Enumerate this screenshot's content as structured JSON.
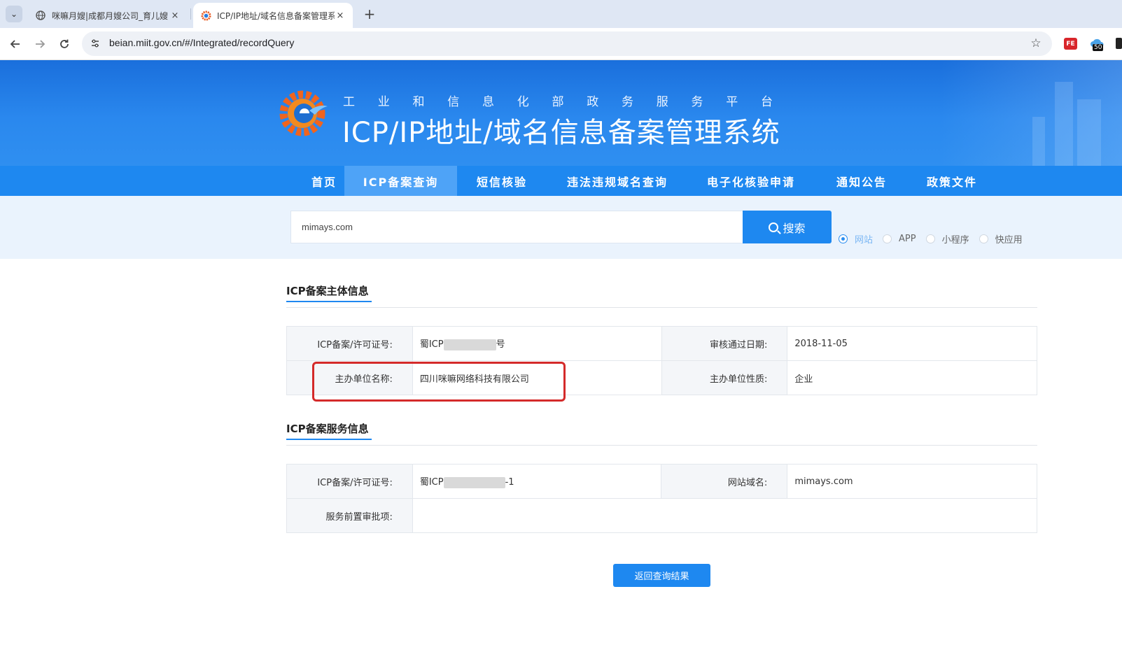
{
  "browser": {
    "tabs": [
      {
        "title": "咪嘛月嫂|成都月嫂公司_育儿嫂",
        "active": false
      },
      {
        "title": "ICP/IP地址/域名信息备案管理系",
        "active": true
      }
    ],
    "tab_close_glyph": "×",
    "new_tab_glyph": "+",
    "url": "beian.miit.gov.cn/#/Integrated/recordQuery",
    "extension_badge": "50",
    "extension_fe_label": "FE",
    "icons": [
      "chevron-down-icon",
      "globe-icon",
      "back-arrow-icon",
      "forward-arrow-icon",
      "reload-icon",
      "site-info-icon",
      "star-icon"
    ]
  },
  "header": {
    "subtitle_chars": [
      "工",
      "业",
      "和",
      "信",
      "息",
      "化",
      "部",
      "政",
      "务",
      "服",
      "务",
      "平",
      "台"
    ],
    "title": "ICP/IP地址/域名信息备案管理系统"
  },
  "nav": {
    "items": [
      {
        "label": "首页",
        "active": false
      },
      {
        "label": "ICP备案查询",
        "active": true
      },
      {
        "label": "短信核验",
        "active": false
      },
      {
        "label": "违法违规域名查询",
        "active": false
      },
      {
        "label": "电子化核验申请",
        "active": false
      },
      {
        "label": "通知公告",
        "active": false
      },
      {
        "label": "政策文件",
        "active": false
      }
    ]
  },
  "search": {
    "value": "mimays.com",
    "button_label": "搜索",
    "types": [
      {
        "label": "网站",
        "checked": true
      },
      {
        "label": "APP",
        "checked": false
      },
      {
        "label": "小程序",
        "checked": false
      },
      {
        "label": "快应用",
        "checked": false
      }
    ]
  },
  "subject_section": {
    "title": "ICP备案主体信息",
    "rows": [
      {
        "k1": "ICP备案/许可证号:",
        "v1_prefix": "蜀ICP",
        "v1_suffix": "号",
        "k2": "审核通过日期:",
        "v2": "2018-11-05"
      },
      {
        "k1": "主办单位名称:",
        "v1": "四川咪嘛网络科技有限公司",
        "k2": "主办单位性质:",
        "v2": "企业"
      }
    ]
  },
  "service_section": {
    "title": "ICP备案服务信息",
    "rows": [
      {
        "k1": "ICP备案/许可证号:",
        "v1_prefix": "蜀ICP",
        "v1_suffix": "-1",
        "k2": "网站域名:",
        "v2": "mimays.com"
      },
      {
        "k1": "服务前置审批项:",
        "v1": ""
      }
    ]
  },
  "actions": {
    "back_label": "返回查询结果"
  },
  "colors": {
    "primary": "#1e88f0",
    "highlight": "#d42a2a"
  }
}
